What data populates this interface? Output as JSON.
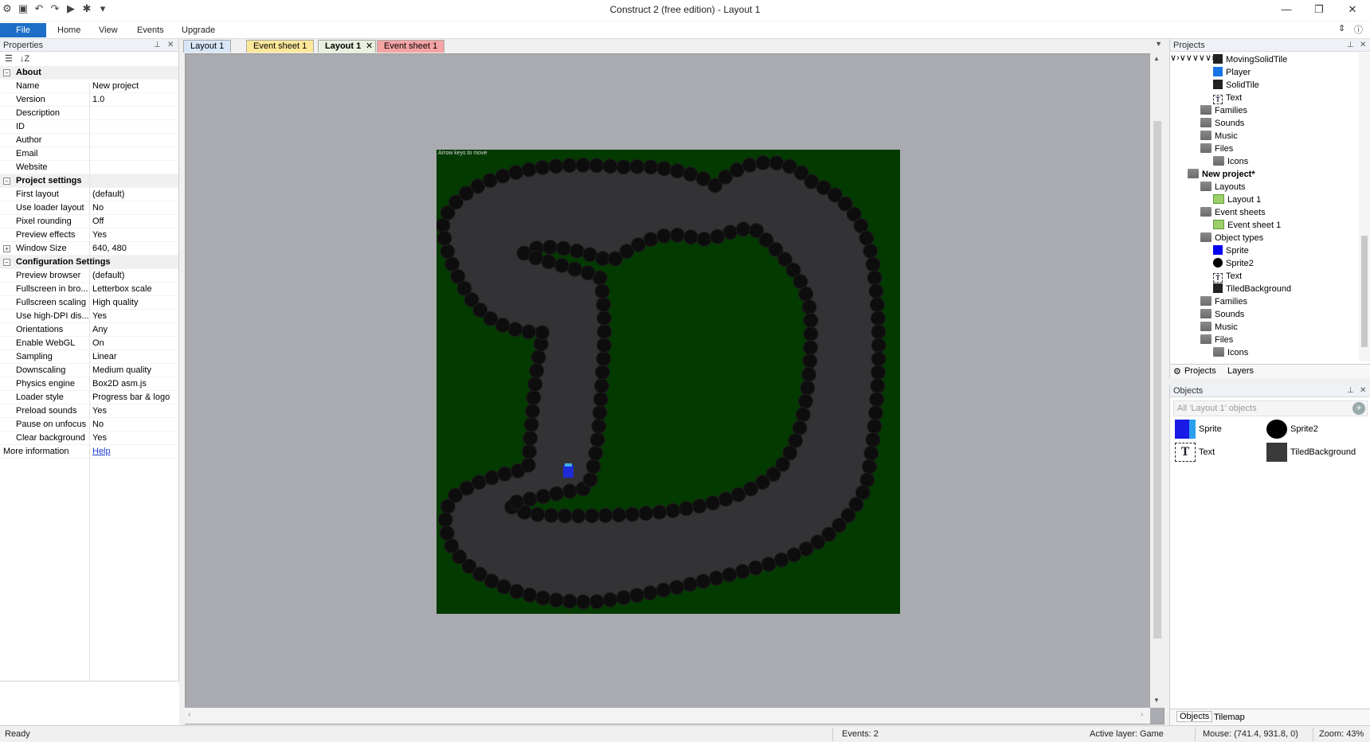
{
  "app": {
    "title": "Construct 2  (free edition) - Layout 1"
  },
  "qat_icons": [
    "app-icon",
    "save-icon",
    "undo-icon",
    "redo-icon",
    "run-icon",
    "debug-icon",
    "customize-icon"
  ],
  "ribbon": {
    "tabs": [
      "File",
      "Home",
      "View",
      "Events",
      "Upgrade"
    ]
  },
  "properties": {
    "title": "Properties",
    "sections": [
      {
        "label": "About",
        "rows": [
          {
            "k": "Name",
            "v": "New project"
          },
          {
            "k": "Version",
            "v": "1.0"
          },
          {
            "k": "Description",
            "v": ""
          },
          {
            "k": "ID",
            "v": ""
          },
          {
            "k": "Author",
            "v": ""
          },
          {
            "k": "Email",
            "v": ""
          },
          {
            "k": "Website",
            "v": ""
          }
        ]
      },
      {
        "label": "Project settings",
        "rows": [
          {
            "k": "First layout",
            "v": "(default)"
          },
          {
            "k": "Use loader layout",
            "v": "No"
          },
          {
            "k": "Pixel rounding",
            "v": "Off"
          },
          {
            "k": "Preview effects",
            "v": "Yes"
          },
          {
            "k": "Window Size",
            "v": "640, 480"
          }
        ]
      },
      {
        "label": "Configuration Settings",
        "rows": [
          {
            "k": "Preview browser",
            "v": "(default)"
          },
          {
            "k": "Fullscreen in bro...",
            "v": "Letterbox scale"
          },
          {
            "k": "Fullscreen scaling",
            "v": "High quality"
          },
          {
            "k": "Use high-DPI dis...",
            "v": "Yes"
          },
          {
            "k": "Orientations",
            "v": "Any"
          },
          {
            "k": "Enable WebGL",
            "v": "On"
          },
          {
            "k": "Sampling",
            "v": "Linear"
          },
          {
            "k": "Downscaling",
            "v": "Medium quality"
          },
          {
            "k": "Physics engine",
            "v": "Box2D asm.js"
          },
          {
            "k": "Loader style",
            "v": "Progress bar & logo"
          },
          {
            "k": "Preload sounds",
            "v": "Yes"
          },
          {
            "k": "Pause on unfocus",
            "v": "No"
          },
          {
            "k": "Clear background",
            "v": "Yes"
          }
        ]
      }
    ],
    "more_info_label": "More information",
    "help_link": "Help"
  },
  "doc_tabs": [
    {
      "label": "Layout 1",
      "kind": "layout"
    },
    {
      "label": "Event sheet 1",
      "kind": "event"
    },
    {
      "label": "Layout 1",
      "kind": "active"
    },
    {
      "label": "Event sheet 1",
      "kind": "event2"
    }
  ],
  "canvas": {
    "hint_text": "Arrow keys to move"
  },
  "projects": {
    "title": "Projects",
    "tree": [
      {
        "label": "MovingSolidTile",
        "icon": "black",
        "indent": 3
      },
      {
        "label": "Player",
        "icon": "blue",
        "indent": 3
      },
      {
        "label": "SolidTile",
        "icon": "black",
        "indent": 3
      },
      {
        "label": "Text",
        "icon": "text",
        "indent": 3
      },
      {
        "label": "Families",
        "icon": "folder",
        "indent": 2
      },
      {
        "label": "Sounds",
        "icon": "folder",
        "indent": 2
      },
      {
        "label": "Music",
        "icon": "folder",
        "indent": 2
      },
      {
        "label": "Files",
        "icon": "folder",
        "indent": 2,
        "chev": "open"
      },
      {
        "label": "Icons",
        "icon": "folder",
        "indent": 3,
        "chev": "closed"
      },
      {
        "label": "New project*",
        "icon": "folder",
        "indent": 1,
        "chev": "open",
        "bold": true
      },
      {
        "label": "Layouts",
        "icon": "folder",
        "indent": 2,
        "chev": "open"
      },
      {
        "label": "Layout 1",
        "icon": "green",
        "indent": 3
      },
      {
        "label": "Event sheets",
        "icon": "folder",
        "indent": 2,
        "chev": "open"
      },
      {
        "label": "Event sheet 1",
        "icon": "green",
        "indent": 3
      },
      {
        "label": "Object types",
        "icon": "folder",
        "indent": 2,
        "chev": "open"
      },
      {
        "label": "Sprite",
        "icon": "bluesq",
        "indent": 3
      },
      {
        "label": "Sprite2",
        "icon": "circle",
        "indent": 3
      },
      {
        "label": "Text",
        "icon": "text",
        "indent": 3
      },
      {
        "label": "TiledBackground",
        "icon": "black",
        "indent": 3
      },
      {
        "label": "Families",
        "icon": "folder",
        "indent": 2
      },
      {
        "label": "Sounds",
        "icon": "folder",
        "indent": 2
      },
      {
        "label": "Music",
        "icon": "folder",
        "indent": 2
      },
      {
        "label": "Files",
        "icon": "folder",
        "indent": 2,
        "chev": "open"
      },
      {
        "label": "Icons",
        "icon": "folder",
        "indent": 3,
        "chev": "closed"
      }
    ],
    "tabs": [
      "Projects",
      "Layers"
    ]
  },
  "objects": {
    "title": "Objects",
    "filter_placeholder": "All 'Layout 1' objects",
    "items": [
      {
        "label": "Sprite"
      },
      {
        "label": "Sprite2"
      },
      {
        "label": "Text"
      },
      {
        "label": "TiledBackground"
      }
    ],
    "tabs": [
      "Objects",
      "Tilemap"
    ]
  },
  "status": {
    "ready": "Ready",
    "events": "Events: 2",
    "active_layer": "Active layer: Game",
    "mouse": "Mouse: (741.4, 931.8, 0)",
    "zoom": "Zoom: 43%"
  }
}
